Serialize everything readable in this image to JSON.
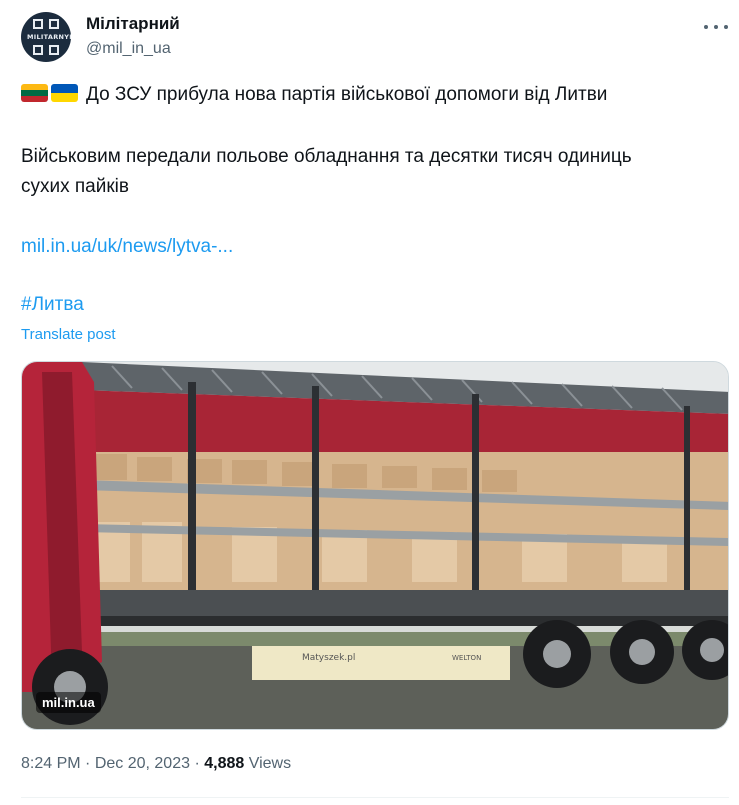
{
  "author": {
    "display_name": "Мілітарний",
    "handle": "@mil_in_ua",
    "avatar_text": "MILITARNYI"
  },
  "post": {
    "headline": "До ЗСУ прибула нова партія військової допомоги від Литви",
    "body_line1": "Військовим передали польове обладнання та десятки тисяч одиниць",
    "body_line2": "сухих пайків",
    "link": "mil.in.ua/uk/news/lytva-...",
    "hashtag": "#Литва",
    "translate": "Translate post",
    "flags": [
      "lithuania-flag",
      "ukraine-flag"
    ]
  },
  "media": {
    "watermark": "mil.in.ua",
    "trailer_brand": "Matyszek.pl",
    "trailer_plate": "WELTON"
  },
  "meta": {
    "time": "8:24 PM",
    "separator": " · ",
    "date": "Dec 20, 2023",
    "views_count": "4,888",
    "views_label": " Views"
  },
  "colors": {
    "accent": "#1d9bf0",
    "text": "#0f1419",
    "secondary": "#536471",
    "curtain": "#b5243a"
  }
}
